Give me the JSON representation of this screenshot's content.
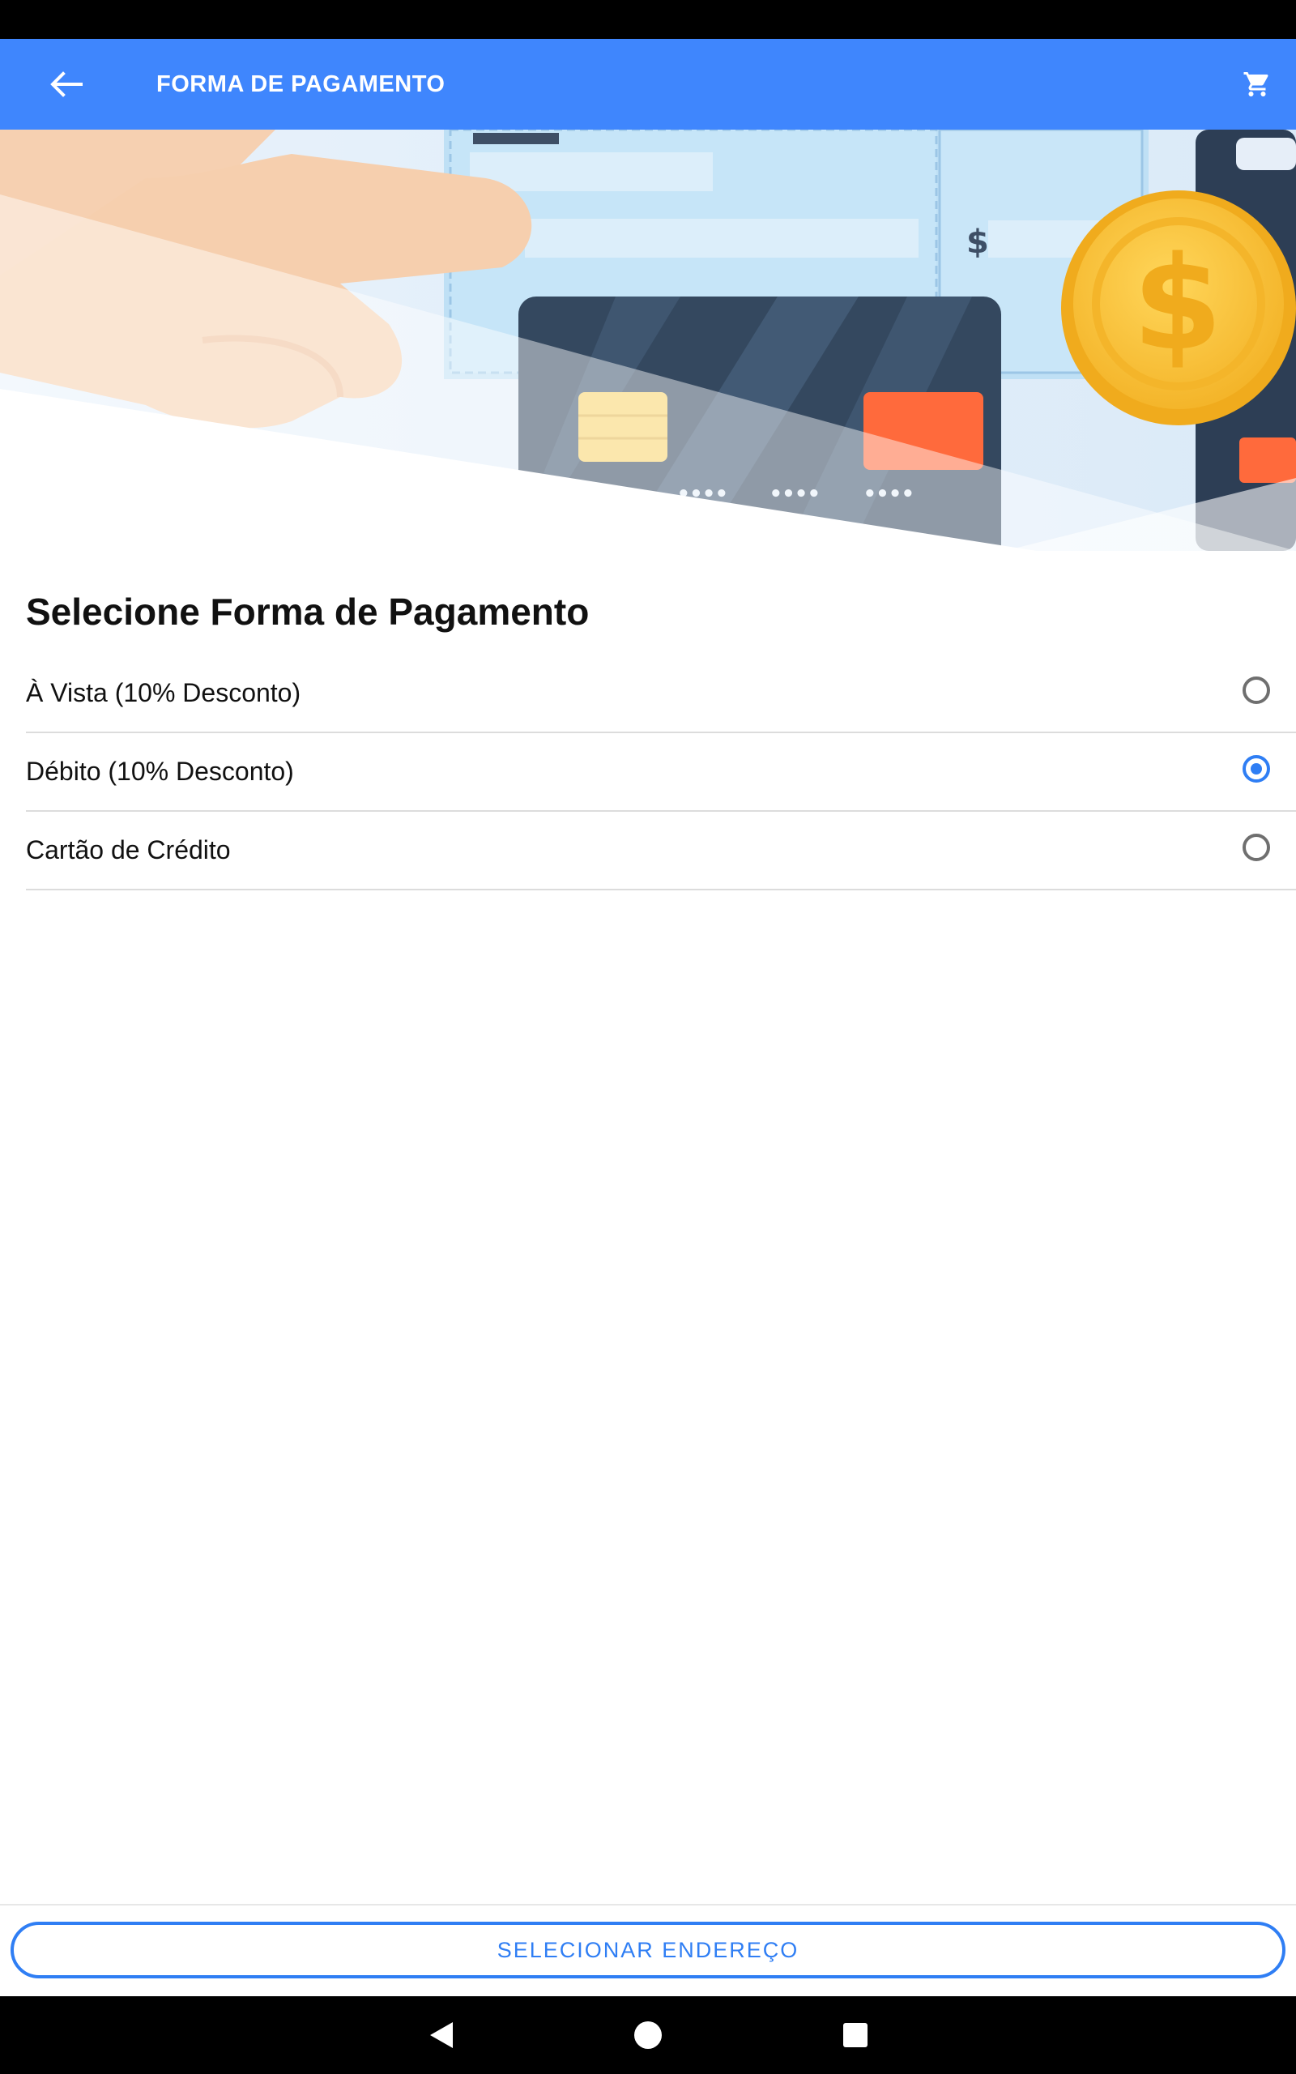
{
  "app_bar": {
    "title": "FORMA DE PAGAMENTO",
    "back_icon": "arrow-left-icon",
    "cart_icon": "shopping-cart-icon",
    "background": "#3f86fd"
  },
  "banner": {
    "description_icon": "payment-illustration",
    "coin_symbol": "$",
    "card_number_groups": [
      "••••",
      "••••",
      "••••"
    ]
  },
  "main": {
    "section_title": "Selecione Forma de Pagamento",
    "options": [
      {
        "label": "À Vista (10% Desconto)",
        "selected": false
      },
      {
        "label": "Débito (10% Desconto)",
        "selected": true
      },
      {
        "label": "Cartão de Crédito",
        "selected": false
      }
    ]
  },
  "footer": {
    "button_label": "SELECIONAR ENDEREÇO",
    "accent": "#2f7ef4"
  },
  "nav": {
    "back": "nav-back-icon",
    "home": "nav-home-icon",
    "recents": "nav-recents-icon"
  }
}
